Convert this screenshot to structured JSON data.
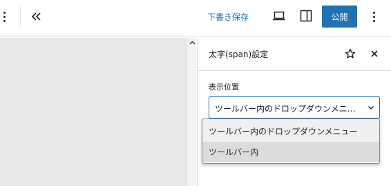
{
  "toolbar": {
    "collapse_label": "«",
    "save_draft_label": "下書き保存",
    "publish_label": "公開",
    "accent_color": "#2271b1"
  },
  "icons": {
    "more_left": "more-vertical-icon",
    "collapse": "double-chevron-left-icon",
    "preview": "laptop-icon",
    "sidebar": "sidebar-toggle-icon",
    "more_right": "more-vertical-icon",
    "scroll_up": "caret-up-icon",
    "star": "star-outline-icon",
    "close": "close-icon",
    "select": "chevron-down-icon"
  },
  "panel": {
    "title": "太字(span)設定",
    "field_label": "表示位置",
    "select_value": "ツールバー内のドロップダウンメニュー",
    "options": [
      {
        "label": "ツールバー内のドロップダウンメニュー",
        "highlighted": false
      },
      {
        "label": "ツールバー内",
        "highlighted": true
      }
    ]
  }
}
